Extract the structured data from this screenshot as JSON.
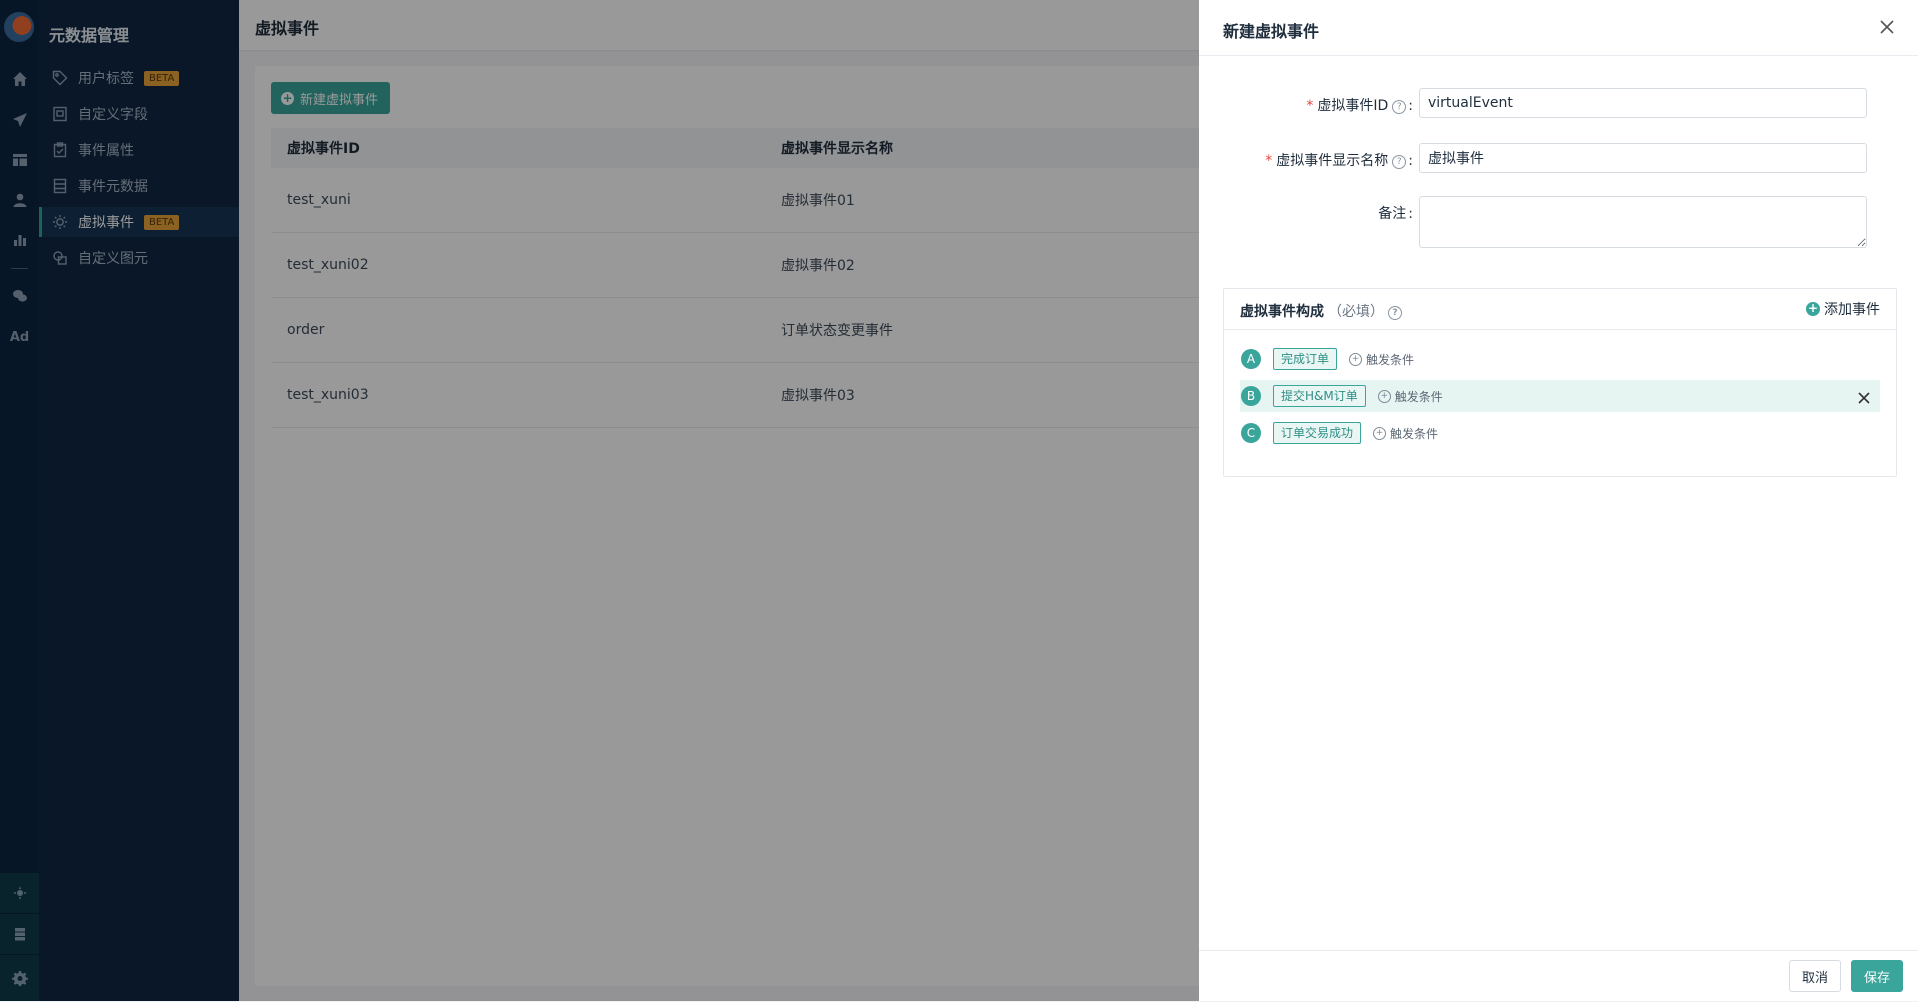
{
  "sidebar": {
    "section_title": "元数据管理",
    "rail_icons": [
      "home-icon",
      "send-icon",
      "table-icon",
      "user-icon",
      "bar-chart-icon",
      "wechat-icon",
      "ad-icon"
    ],
    "rail_ad_label": "Ad",
    "items": [
      {
        "label": "用户标签",
        "icon": "tag-icon",
        "badge": "BETA"
      },
      {
        "label": "自定义字段",
        "icon": "document-icon"
      },
      {
        "label": "事件属性",
        "icon": "clipboard-icon"
      },
      {
        "label": "事件元数据",
        "icon": "database-icon"
      },
      {
        "label": "虚拟事件",
        "icon": "virtual-event-icon",
        "badge": "BETA",
        "active": true
      },
      {
        "label": "自定义图元",
        "icon": "shapes-icon"
      }
    ]
  },
  "page": {
    "title": "虚拟事件",
    "new_button": "新建虚拟事件",
    "table": {
      "columns": [
        "虚拟事件ID",
        "虚拟事件显示名称"
      ],
      "rows": [
        [
          "test_xuni",
          "虚拟事件01"
        ],
        [
          "test_xuni02",
          "虚拟事件02"
        ],
        [
          "order",
          "订单状态变更事件"
        ],
        [
          "test_xuni03",
          "虚拟事件03"
        ]
      ]
    }
  },
  "drawer": {
    "title": "新建虚拟事件",
    "fields": {
      "id_label": "虚拟事件ID",
      "id_value": "virtualEvent",
      "name_label": "虚拟事件显示名称",
      "name_value": "虚拟事件",
      "note_label": "备注"
    },
    "composition": {
      "title": "虚拟事件构成",
      "required_hint": "（必填）",
      "add_label": "添加事件",
      "events": [
        {
          "letter": "A",
          "name": "完成订单",
          "condition": "触发条件"
        },
        {
          "letter": "B",
          "name": "提交H&M订单",
          "condition": "触发条件",
          "highlighted": true
        },
        {
          "letter": "C",
          "name": "订单交易成功",
          "condition": "触发条件"
        }
      ]
    },
    "cancel": "取消",
    "save": "保存"
  },
  "colors": {
    "accent": "#3aa59b",
    "sidebar_bg": "#0f2744",
    "rail_bg": "#0d2540",
    "badge": "#e8a33a",
    "required": "#e4463c"
  }
}
